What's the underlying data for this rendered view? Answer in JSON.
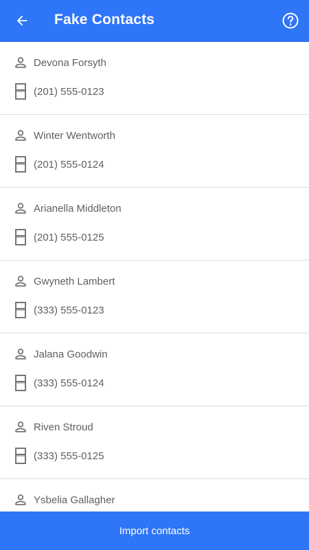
{
  "appbar": {
    "title": "Fake Contacts",
    "back_icon": "arrow-back-icon",
    "help_icon": "help-circle-icon",
    "color": "#2f75f7"
  },
  "contacts": [
    {
      "name": "Devona Forsyth",
      "phone": "(201) 555-0123"
    },
    {
      "name": "Winter Wentworth",
      "phone": "(201) 555-0124"
    },
    {
      "name": "Arianella Middleton",
      "phone": "(201) 555-0125"
    },
    {
      "name": "Gwyneth Lambert",
      "phone": "(333) 555-0123"
    },
    {
      "name": "Jalana Goodwin",
      "phone": "(333) 555-0124"
    },
    {
      "name": "Riven Stroud",
      "phone": "(333) 555-0125"
    },
    {
      "name": "Ysbelia Gallagher",
      "phone": ""
    }
  ],
  "footer": {
    "import_label": "Import contacts",
    "color": "#2f75f7"
  },
  "icons": {
    "person": "person-icon",
    "phone": "phone-icon"
  }
}
